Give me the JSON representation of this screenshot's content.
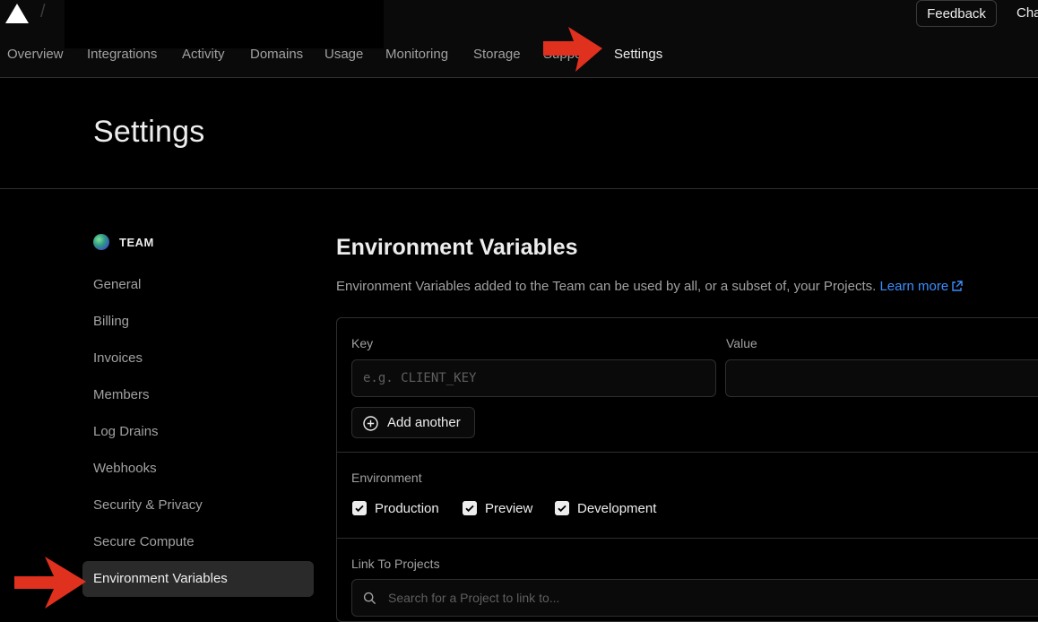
{
  "header": {
    "separator": "/",
    "feedback_label": "Feedback",
    "cut_label": "Cha"
  },
  "tabs": [
    "Overview",
    "Integrations",
    "Activity",
    "Domains",
    "Usage",
    "Monitoring",
    "Storage",
    "Support",
    "Settings"
  ],
  "active_tab": "Settings",
  "page": {
    "title": "Settings"
  },
  "sidebar": {
    "team_label": "TEAM",
    "items": [
      "General",
      "Billing",
      "Invoices",
      "Members",
      "Log Drains",
      "Webhooks",
      "Security & Privacy",
      "Secure Compute",
      "Environment Variables"
    ],
    "active_item": "Environment Variables"
  },
  "main": {
    "title": "Environment Variables",
    "description": "Environment Variables added to the Team can be used by all, or a subset of, your Projects.",
    "learn_more": "Learn more",
    "key_label": "Key",
    "key_placeholder": "e.g. CLIENT_KEY",
    "value_label": "Value",
    "value_value": "",
    "add_another": "Add another",
    "environment_label": "Environment",
    "environments": [
      {
        "label": "Production",
        "checked": true
      },
      {
        "label": "Preview",
        "checked": true
      },
      {
        "label": "Development",
        "checked": true
      }
    ],
    "link_label": "Link To Projects",
    "search_placeholder": "Search for a Project to link to..."
  },
  "colors": {
    "background": "#000000",
    "header_bg": "#0a0a0a",
    "link": "#3b8eff",
    "annotation_arrow": "#e0301e",
    "active_nav_bg": "#2a2a2a"
  }
}
